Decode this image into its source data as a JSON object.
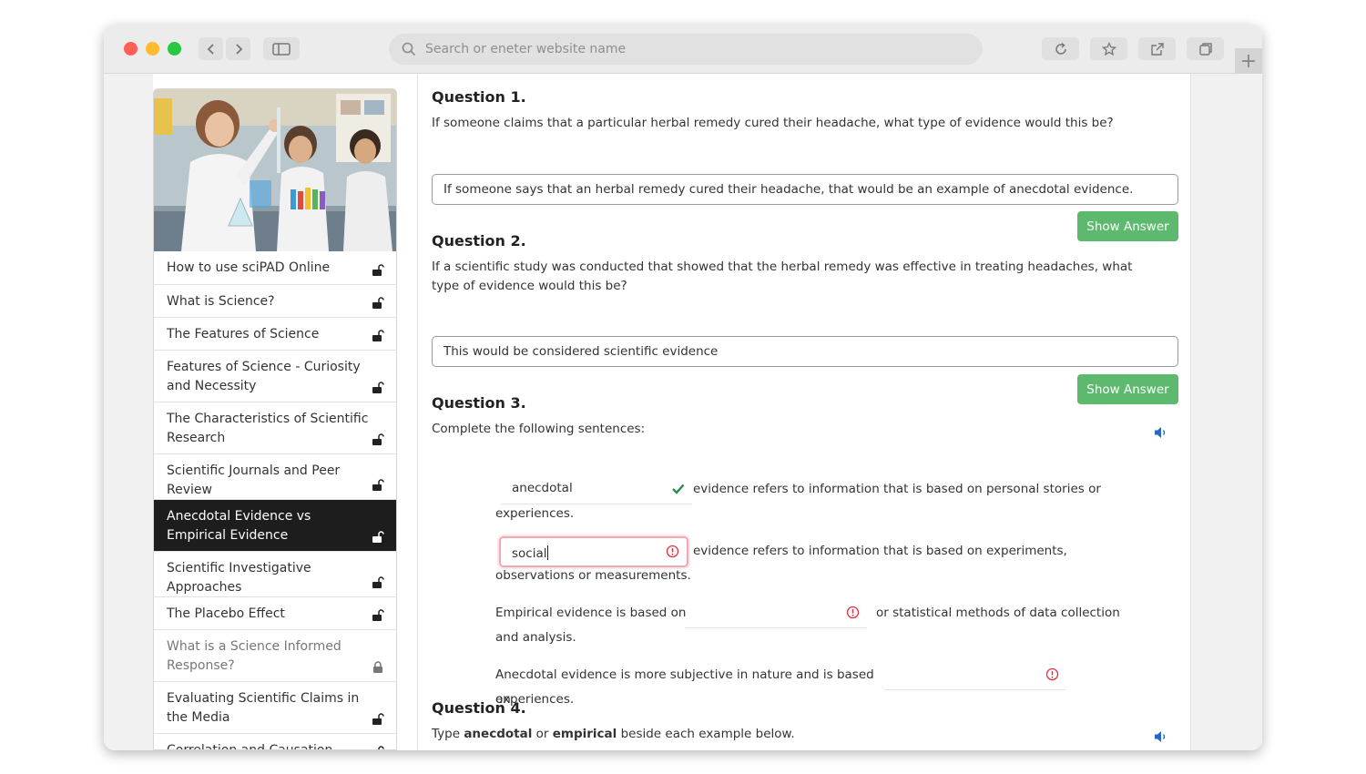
{
  "browser": {
    "search_placeholder": "Search or eneter website name"
  },
  "sidebar": {
    "items": [
      {
        "label": "How to use sciPAD Online"
      },
      {
        "label": "What is Science?"
      },
      {
        "label": "The Features of Science"
      },
      {
        "label": "Features of Science - Curiosity and Necessity"
      },
      {
        "label": "The Characteristics of Scientific Research"
      },
      {
        "label": "Scientific Journals and Peer Review"
      },
      {
        "label": "Anecdotal Evidence vs Empirical Evidence"
      },
      {
        "label": "Scientific Investigative Approaches"
      },
      {
        "label": "The Placebo Effect"
      },
      {
        "label": "What is a Science Informed Response?"
      },
      {
        "label": "Evaluating Scientific Claims in the Media"
      },
      {
        "label": "Correlation and Causation"
      }
    ]
  },
  "questions": {
    "q1": {
      "title": "Question 1.",
      "text": "If someone claims that a particular herbal remedy cured their headache, what type of evidence would this be?",
      "answer": "If someone says that an herbal remedy cured their headache, that would be an example of anecdotal evidence.",
      "button": "Show Answer"
    },
    "q2": {
      "title": "Question 2.",
      "text": "If a scientific study was conducted that showed that the herbal remedy was effective in treating headaches, what type of evidence would this be?",
      "answer": "This would be considered scientific evidence",
      "button": "Show Answer"
    },
    "q3": {
      "title": "Question 3.",
      "text": "Complete the following sentences:",
      "s1_value": "anecdotal",
      "s1_after": "evidence refers to information that is based on personal stories or",
      "s1_cont": "experiences.",
      "s2_value": "social",
      "s2_after": "evidence refers to information that is based on experiments,",
      "s2_cont": "observations or measurements.",
      "s3_before": "Empirical evidence is based on",
      "s3_after": "or statistical methods of data collection",
      "s3_cont": "and analysis.",
      "s4_before": "Anecdotal evidence is more subjective in nature and is based on",
      "s4_cont": "experiences."
    },
    "q4": {
      "title": "Question 4.",
      "text_pre": "Type ",
      "bold1": "anecdotal",
      "text_mid": " or ",
      "bold2": "empirical",
      "text_post": " beside each example below."
    }
  },
  "colors": {
    "accent_green": "#5cb96e",
    "active_nav": "#1d1d1d",
    "error_red": "#e0313f",
    "check_green": "#2a8a4a",
    "speaker_blue": "#2767c2"
  }
}
